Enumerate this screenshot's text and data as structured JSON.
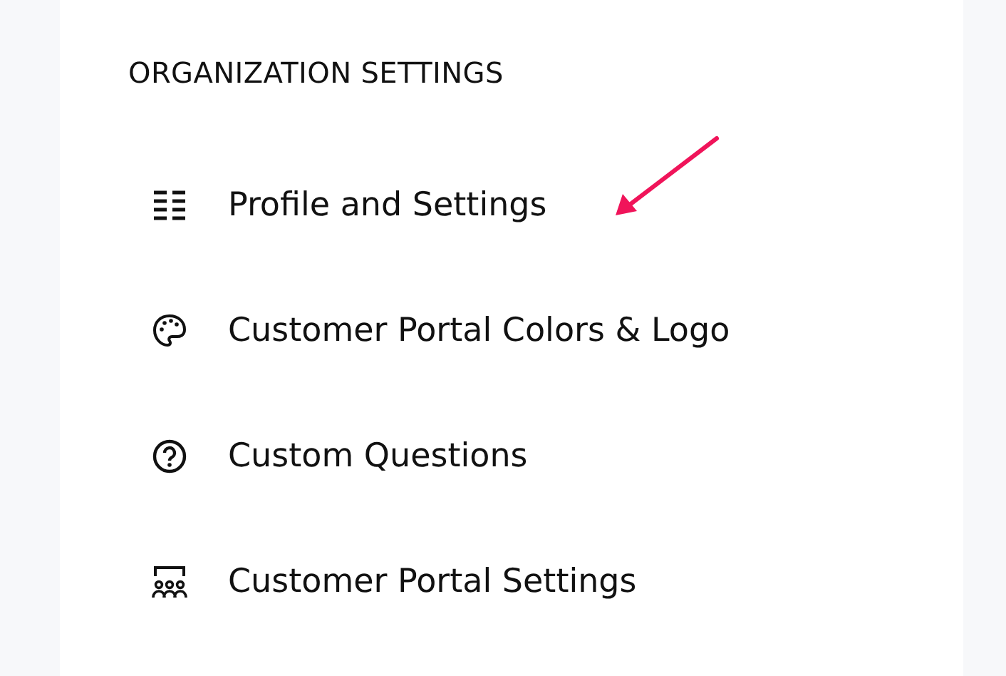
{
  "section_title": "ORGANIZATION SETTINGS",
  "items": [
    {
      "label": "Profile and Settings"
    },
    {
      "label": "Customer Portal Colors & Logo"
    },
    {
      "label": "Custom Questions"
    },
    {
      "label": "Customer Portal Settings"
    }
  ]
}
